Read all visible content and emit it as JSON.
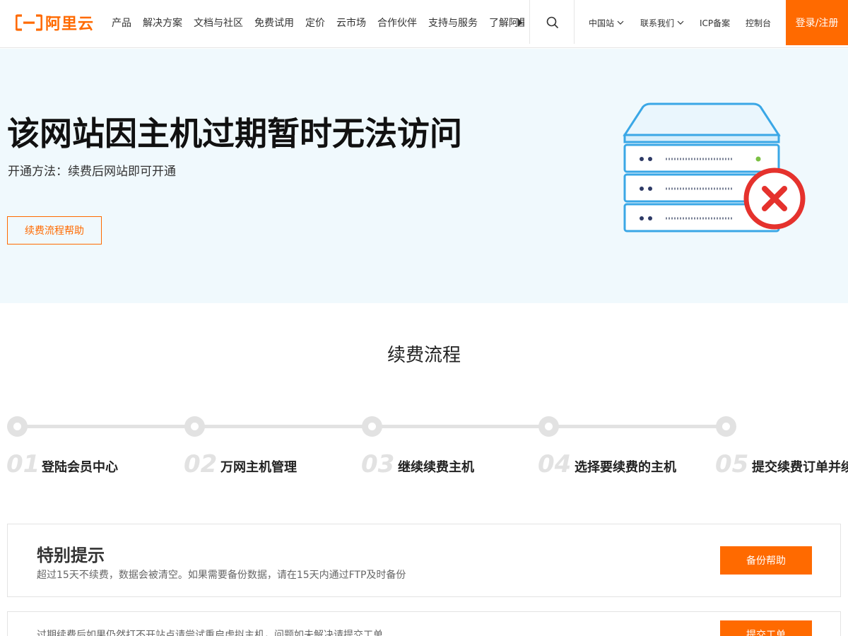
{
  "header": {
    "logo_text": "阿里云",
    "nav_items": [
      "产品",
      "解决方案",
      "文档与社区",
      "免费试用",
      "定价",
      "云市场",
      "合作伙伴",
      "支持与服务",
      "了解阿里云"
    ],
    "site_label": "中国站",
    "contact_label": "联系我们",
    "icp_label": "ICP备案",
    "console_label": "控制台",
    "login_label": "登录/注册",
    "brand_color": "#ff6a00"
  },
  "hero": {
    "title": "该网站因主机过期暂时无法访问",
    "subtitle": "开通方法：续费后网站即可开通",
    "button_label": "续费流程帮助"
  },
  "process": {
    "title": "续费流程",
    "steps": [
      {
        "num": "01",
        "label": "登陆会员中心"
      },
      {
        "num": "02",
        "label": "万网主机管理"
      },
      {
        "num": "03",
        "label": "继续续费主机"
      },
      {
        "num": "04",
        "label": "选择要续费的主机"
      },
      {
        "num": "05",
        "label": "提交续费订单并续费"
      }
    ]
  },
  "notice1": {
    "title": "特别提示",
    "text": "超过15天不续费，数据会被清空。如果需要备份数据，请在15天内通过FTP及时备份",
    "button_label": "备份帮助"
  },
  "notice2": {
    "text": "过期续费后如果仍然打不开站点请尝试重启虚拟主机，问题如未解决请提交工单",
    "button_label": "提交工单"
  }
}
